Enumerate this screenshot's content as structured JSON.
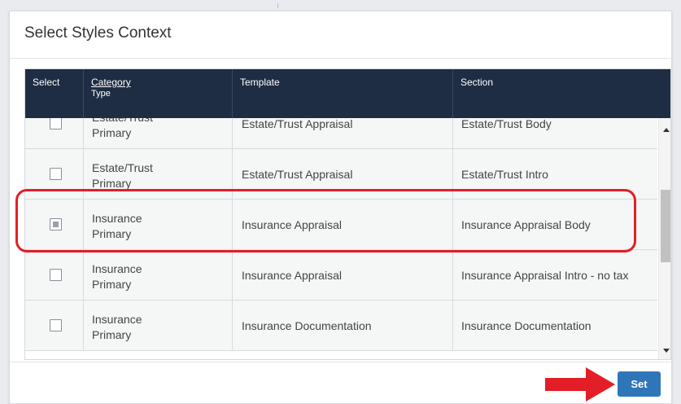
{
  "dialog": {
    "title": "Select Styles Context"
  },
  "table": {
    "headers": {
      "select": "Select",
      "category": "Category",
      "type": "Type",
      "template": "Template",
      "section": "Section"
    },
    "rows": [
      {
        "category": "Estate/Trust",
        "type": "Primary",
        "template": "Estate/Trust Appraisal",
        "section": "Estate/Trust Body",
        "checked": false
      },
      {
        "category": "Estate/Trust",
        "type": "Primary",
        "template": "Estate/Trust Appraisal",
        "section": "Estate/Trust Intro",
        "checked": false
      },
      {
        "category": "Insurance",
        "type": "Primary",
        "template": "Insurance Appraisal",
        "section": "Insurance Appraisal Body",
        "checked": true
      },
      {
        "category": "Insurance",
        "type": "Primary",
        "template": "Insurance Appraisal",
        "section": "Insurance Appraisal Intro - no tax",
        "checked": false
      },
      {
        "category": "Insurance",
        "type": "Primary",
        "template": "Insurance Documentation",
        "section": "Insurance Documentation",
        "checked": false
      }
    ]
  },
  "footer": {
    "set_label": "Set"
  },
  "colors": {
    "header_bg": "#1f2d44",
    "button_bg": "#2f76b9",
    "annotation_red": "#e41e26"
  },
  "icons": {
    "scroll_up": "triangle-up-icon",
    "scroll_down": "triangle-down-icon",
    "annotation": "red-arrow-icon"
  }
}
